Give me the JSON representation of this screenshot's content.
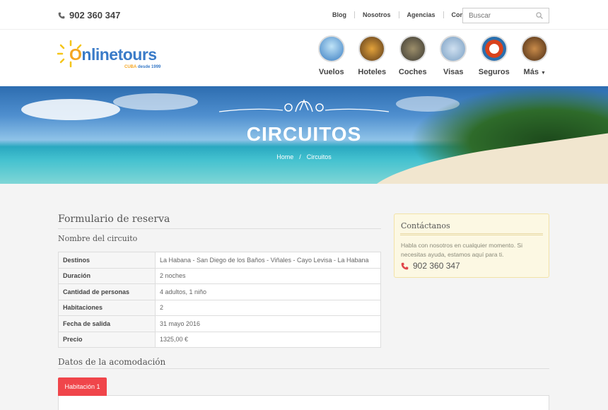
{
  "topbar": {
    "phone": "902 360 347",
    "links": [
      "Blog",
      "Nosotros",
      "Agencias",
      "Contáctanos"
    ],
    "search_placeholder": "Buscar"
  },
  "logo": {
    "word_first": "O",
    "word_rest": "nline",
    "word_second": "tours",
    "tag_country": "CUBA",
    "tag_since": "desde 1999"
  },
  "nav": [
    {
      "label": "Vuelos",
      "icon": "plane-photo"
    },
    {
      "label": "Hoteles",
      "icon": "hotel-photo"
    },
    {
      "label": "Coches",
      "icon": "car-photo"
    },
    {
      "label": "Visas",
      "icon": "visa-photo"
    },
    {
      "label": "Seguros",
      "icon": "lifebuoy-photo"
    },
    {
      "label": "Más",
      "icon": "compass-photo"
    }
  ],
  "banner": {
    "title": "CIRCUITOS",
    "breadcrumb": [
      "Home",
      "Circuitos"
    ],
    "separator": "/"
  },
  "form": {
    "title": "Formulario de reserva",
    "subtitle": "Nombre del circuito",
    "rows": [
      {
        "key": "Destinos",
        "value": "La Habana - San Diego de los Baños - Viñales - Cayo Levisa - La Habana"
      },
      {
        "key": "Duración",
        "value": "2 noches"
      },
      {
        "key": "Cantidad de personas",
        "value": "4 adultos, 1 niño"
      },
      {
        "key": "Habitaciones",
        "value": "2"
      },
      {
        "key": "Fecha de salida",
        "value": "31 mayo 2016"
      },
      {
        "key": "Precio",
        "value": "1325,00 €"
      }
    ],
    "accommodation_title": "Datos de la acomodación",
    "room_tab": "Habitación 1"
  },
  "contact": {
    "title": "Contáctanos",
    "text": "Habla con nosotros en cualquier momento. Si necesitas ayuda, estamos aquí para ti.",
    "phone": "902 360 347"
  },
  "colors": {
    "accent_red": "#f0454a",
    "brand_blue": "#3a7bc8",
    "brand_orange": "#f5a623",
    "contact_bg": "#fcf8e3"
  }
}
